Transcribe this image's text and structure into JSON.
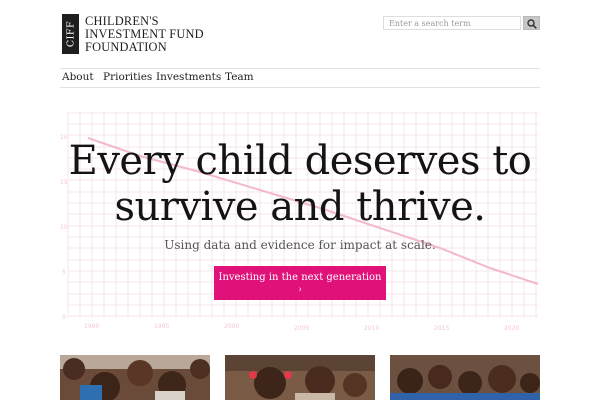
{
  "header": {
    "logo": {
      "mark": "CIFF",
      "lines": [
        "CHILDREN'S",
        "INVESTMENT FUND",
        "FOUNDATION"
      ]
    },
    "search": {
      "placeholder": "Enter a search term",
      "button_icon": "search-icon"
    }
  },
  "nav": {
    "items": [
      "About",
      "Priorities",
      "Investments",
      "Team"
    ]
  },
  "hero": {
    "headline_line1": "Every child deserves to",
    "headline_line2": "survive and thrive.",
    "subhead": "Using data and evidence for impact at scale.",
    "cta_label": "Investing in the next generation",
    "cta_arrow": "›",
    "background_chart": {
      "y_ticks": [
        "20",
        "15",
        "10",
        "5",
        "0"
      ],
      "x_ticks": [
        "1990",
        "1995",
        "2000",
        "2005",
        "2010",
        "2015",
        "2020"
      ]
    }
  },
  "photos": [
    {
      "name": "children-photo-1"
    },
    {
      "name": "children-photo-2"
    },
    {
      "name": "children-photo-3"
    }
  ],
  "colors": {
    "accent": "#e0127a",
    "text": "#1e1e1e",
    "grid": "#f7e4ec"
  }
}
